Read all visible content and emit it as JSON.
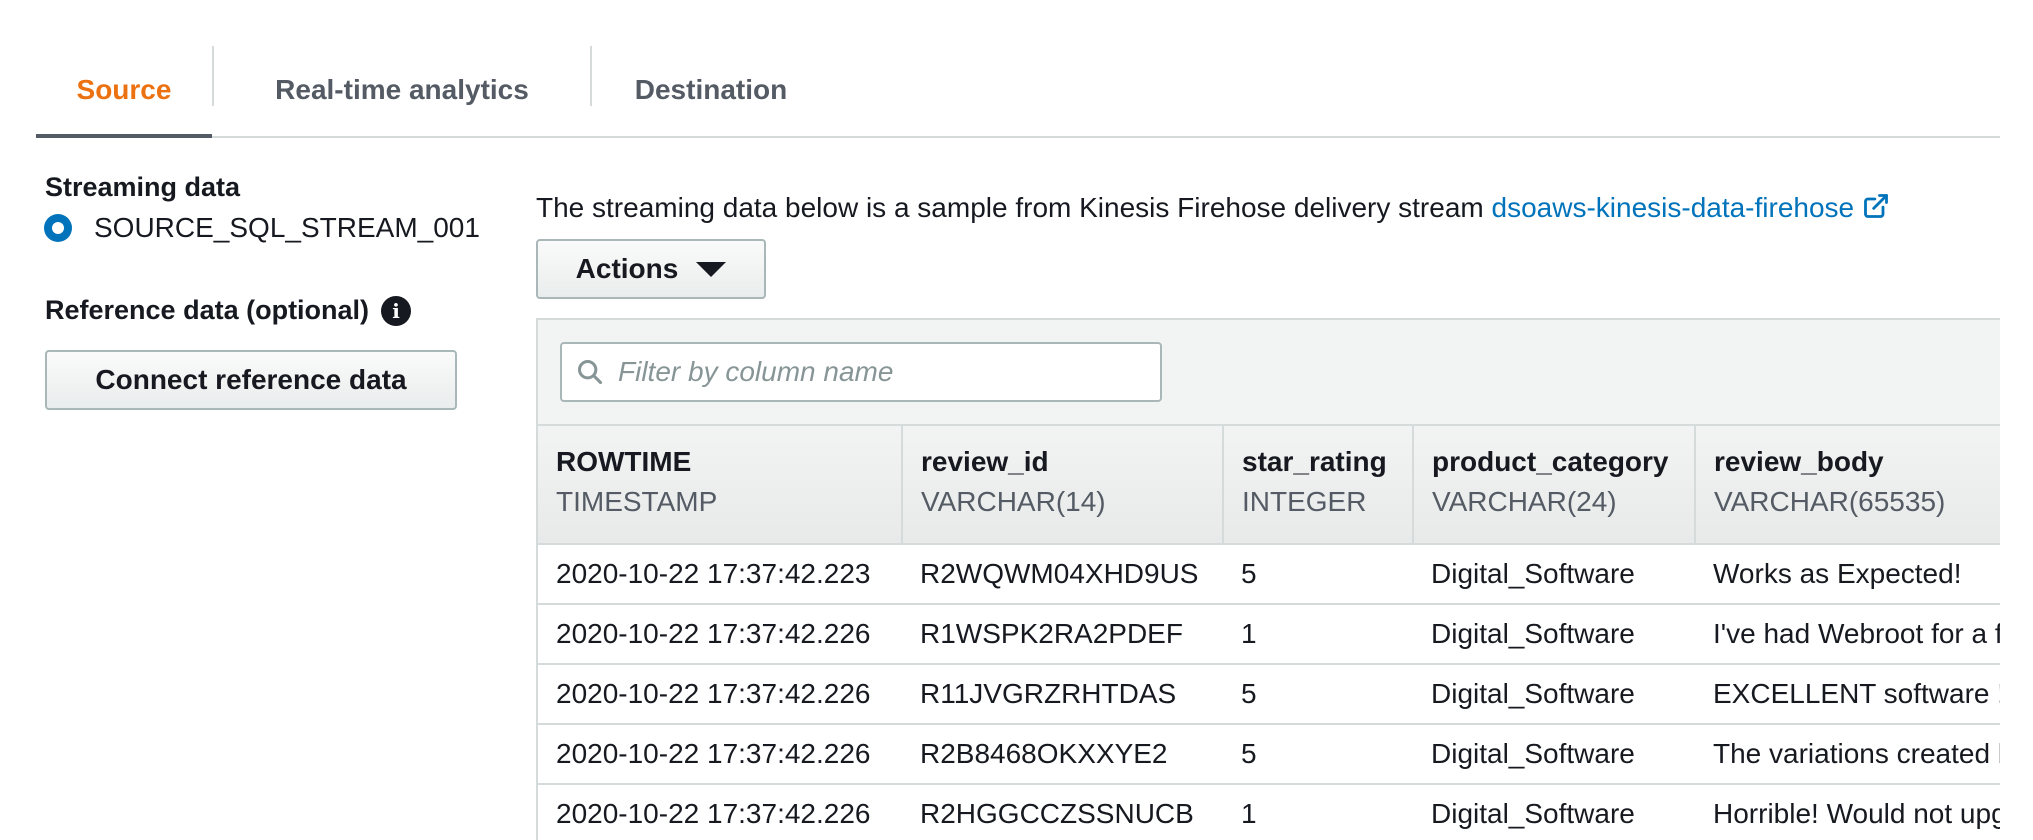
{
  "tabs": [
    {
      "label": "Source",
      "active": true
    },
    {
      "label": "Real-time analytics",
      "active": false
    },
    {
      "label": "Destination",
      "active": false
    }
  ],
  "left": {
    "streaming_label": "Streaming data",
    "stream_option": "SOURCE_SQL_STREAM_001",
    "reference_label": "Reference data (optional)",
    "connect_button": "Connect reference data"
  },
  "main": {
    "description": "The streaming data below is a sample from Kinesis Firehose delivery stream",
    "stream_link": "dsoaws-kinesis-data-firehose",
    "actions_label": "Actions",
    "filter_placeholder": "Filter by column name"
  },
  "table": {
    "columns": [
      {
        "name": "ROWTIME",
        "type": "TIMESTAMP"
      },
      {
        "name": "review_id",
        "type": "VARCHAR(14)"
      },
      {
        "name": "star_rating",
        "type": "INTEGER"
      },
      {
        "name": "product_category",
        "type": "VARCHAR(24)"
      },
      {
        "name": "review_body",
        "type": "VARCHAR(65535)"
      }
    ],
    "rows": [
      [
        "2020-10-22 17:37:42.223",
        "R2WQWM04XHD9US",
        "5",
        "Digital_Software",
        "Works as Expected!"
      ],
      [
        "2020-10-22 17:37:42.226",
        "R1WSPK2RA2PDEF",
        "1",
        "Digital_Software",
        "I've had Webroot for a few"
      ],
      [
        "2020-10-22 17:37:42.226",
        "R11JVGRZRHTDAS",
        "5",
        "Digital_Software",
        "EXCELLENT software !!!"
      ],
      [
        "2020-10-22 17:37:42.226",
        "R2B8468OKXXYE2",
        "5",
        "Digital_Software",
        "The variations created by"
      ],
      [
        "2020-10-22 17:37:42.226",
        "R2HGGCCZSSNUCB",
        "1",
        "Digital_Software",
        "Horrible! Would not upgrade"
      ]
    ]
  },
  "colors": {
    "accent": "#ec7211",
    "link": "#0073bb",
    "radio": "#0073bb"
  }
}
